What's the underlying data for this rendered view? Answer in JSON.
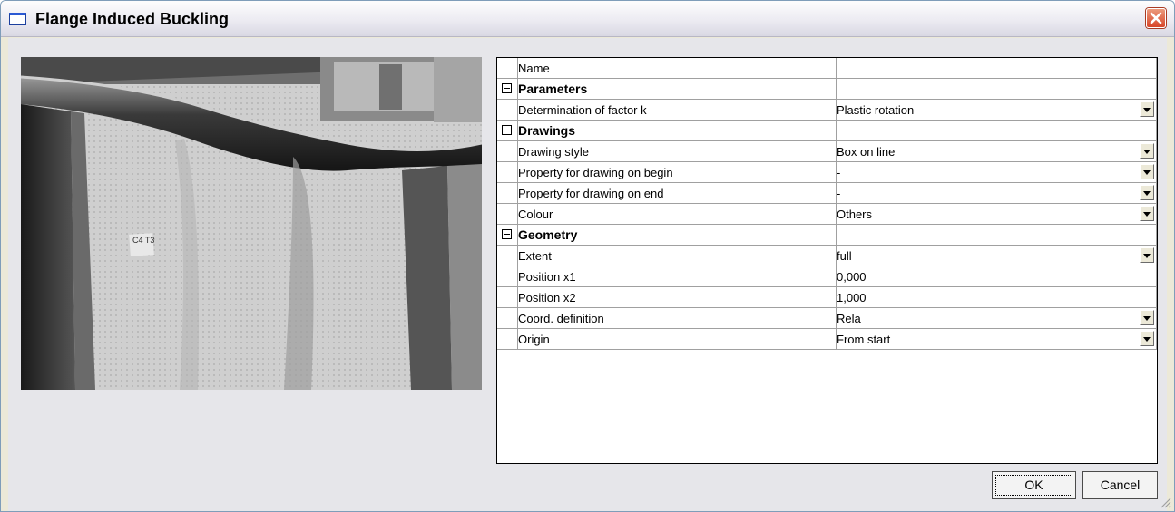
{
  "window": {
    "title": "Flange Induced Buckling",
    "title_icon": "window-icon",
    "close_icon": "close-icon"
  },
  "photo": {
    "label_text": "C4 T3"
  },
  "properties": {
    "rows": [
      {
        "kind": "item",
        "name": "Name",
        "value": "",
        "dropdown": false
      },
      {
        "kind": "category",
        "name": "Parameters"
      },
      {
        "kind": "item",
        "name": "Determination of factor k",
        "value": "Plastic rotation",
        "dropdown": true
      },
      {
        "kind": "category",
        "name": "Drawings"
      },
      {
        "kind": "item",
        "name": "Drawing style",
        "value": "Box on line",
        "dropdown": true
      },
      {
        "kind": "item",
        "name": "Property for drawing on begin",
        "value": "-",
        "dropdown": true
      },
      {
        "kind": "item",
        "name": "Property for drawing on end",
        "value": "-",
        "dropdown": true
      },
      {
        "kind": "item",
        "name": "Colour",
        "value": "Others",
        "dropdown": true
      },
      {
        "kind": "category",
        "name": "Geometry"
      },
      {
        "kind": "item",
        "name": "Extent",
        "value": "full",
        "dropdown": true
      },
      {
        "kind": "item",
        "name": "Position x1",
        "value": "0,000",
        "dropdown": false
      },
      {
        "kind": "item",
        "name": "Position x2",
        "value": "1,000",
        "dropdown": false
      },
      {
        "kind": "item",
        "name": "Coord. definition",
        "value": "Rela",
        "dropdown": true
      },
      {
        "kind": "item",
        "name": "Origin",
        "value": "From start",
        "dropdown": true
      }
    ]
  },
  "buttons": {
    "ok": "OK",
    "cancel": "Cancel"
  },
  "colors": {
    "titlebar": "#ecebf2",
    "client_bg": "#e6e6ea",
    "close_red": "#d8462a",
    "grid_line": "#a0a0a0"
  }
}
